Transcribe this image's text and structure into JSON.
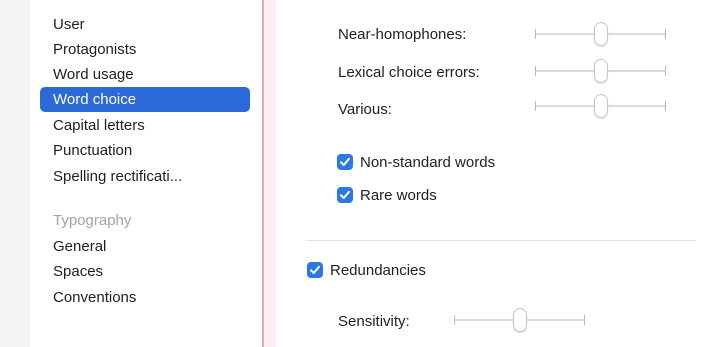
{
  "sidebar": {
    "items": [
      {
        "label": "User",
        "selected": false
      },
      {
        "label": "Protagonists",
        "selected": false
      },
      {
        "label": "Word usage",
        "selected": false
      },
      {
        "label": "Word choice",
        "selected": true
      },
      {
        "label": "Capital letters",
        "selected": false
      },
      {
        "label": "Punctuation",
        "selected": false
      },
      {
        "label": "Spelling rectificati...",
        "selected": false
      }
    ],
    "section_header": "Typography",
    "typography_items": [
      {
        "label": "General"
      },
      {
        "label": "Spaces"
      },
      {
        "label": "Conventions"
      }
    ]
  },
  "settings": {
    "sliders": [
      {
        "label": "Near-homophones:",
        "value": 0.5
      },
      {
        "label": "Lexical choice errors:",
        "value": 0.5
      },
      {
        "label": "Various:",
        "value": 0.5
      }
    ],
    "checkboxes": [
      {
        "label": "Non-standard words",
        "checked": true
      },
      {
        "label": "Rare words",
        "checked": true
      }
    ],
    "redundancies": {
      "label": "Redundancies",
      "checked": true,
      "sensitivity_label": "Sensitivity:",
      "sensitivity_value": 0.5
    }
  },
  "colors": {
    "accent": "#2b69d8",
    "checkbox": "#2b78e4",
    "divider": "#d6b3b8"
  }
}
